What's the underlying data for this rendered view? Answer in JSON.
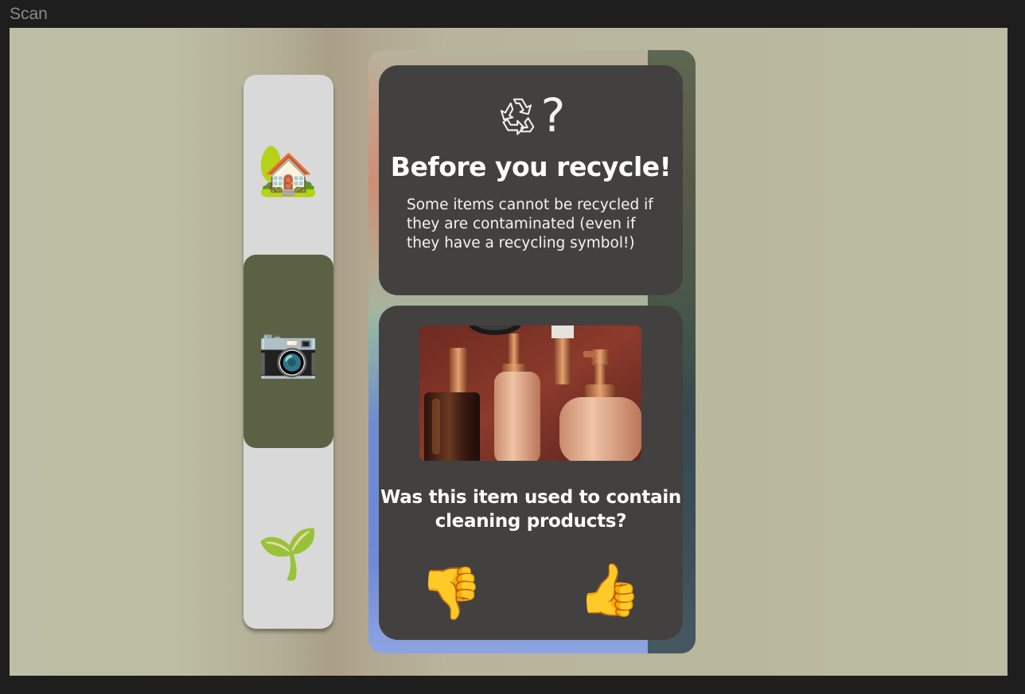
{
  "frame": {
    "label": "Scan"
  },
  "sidebar": {
    "items": [
      {
        "id": "home",
        "emoji": "🏡",
        "active": false
      },
      {
        "id": "scan",
        "emoji": "📷",
        "active": true
      },
      {
        "id": "grow",
        "emoji": "🌱",
        "active": false
      }
    ]
  },
  "info_card": {
    "icon": "recycle-icon",
    "question_mark": "?",
    "title": "Before you recycle!",
    "body": "Some items cannot be recycled if they are contaminated (even if they have a recycling symbol!)"
  },
  "question_card": {
    "image": "cosmetic-bottles-photo",
    "question": "Was this item used to contain cleaning products?",
    "no_emoji": "👎",
    "yes_emoji": "👍"
  },
  "colors": {
    "active_nav": "#5c6143",
    "card": "#434140",
    "sidebar": "#d9d9d9"
  }
}
